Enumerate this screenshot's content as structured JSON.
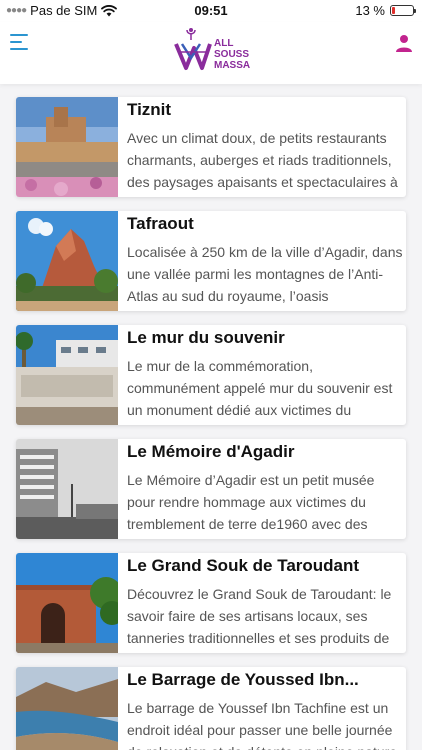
{
  "status_bar": {
    "carrier": "Pas de SIM",
    "time": "09:51",
    "battery": "13 %",
    "battery_level": 0.13
  },
  "header": {
    "logo_text_line1": "ALL",
    "logo_text_line2": "SOUSS",
    "logo_text_line3": "MASSA",
    "brand_color": "#8a2c9c",
    "menu_color": "#2b95d0"
  },
  "places": [
    {
      "title": "Tiznit",
      "description": "Avec un climat doux, de petits restaurants charmants, auberges et riads traditionnels, des paysages apaisants et spectaculaires à"
    },
    {
      "title": "Tafraout",
      "description": "Localisée à 250 km de la ville d’Agadir, dans une vallée parmi les montagnes de l’Anti-Atlas au sud du royaume, l’oasis"
    },
    {
      "title": "Le mur du souvenir",
      "description": "Le mur de la commémoration, communément appelé mur du souvenir est un monument dédié aux victimes du"
    },
    {
      "title": "Le Mémoire d'Agadir",
      "description": "Le Mémoire d’Agadir est un petit musée pour rendre hommage aux victimes du tremblement de terre de1960 avec des"
    },
    {
      "title": "Le Grand Souk de Taroudant",
      "description": "Découvrez le Grand Souk de Taroudant: le savoir faire de ses artisans locaux, ses tanneries traditionnelles et ses produits de"
    },
    {
      "title": "Le Barrage de Youssed Ibn...",
      "description": "Le barrage de Youssef Ibn Tachfine est un endroit idéal pour passer une belle journée de relaxation et de détente en pleine nature"
    }
  ]
}
